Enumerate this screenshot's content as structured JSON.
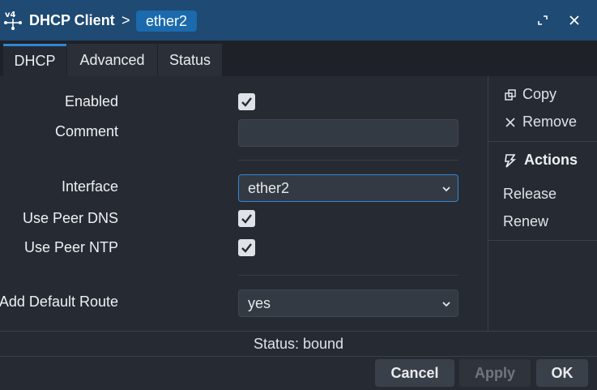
{
  "window": {
    "title": "DHCP Client",
    "separator": ">",
    "object_name": "ether2"
  },
  "tabs": [
    {
      "label": "DHCP",
      "active": true
    },
    {
      "label": "Advanced",
      "active": false
    },
    {
      "label": "Status",
      "active": false
    }
  ],
  "form": {
    "enabled_label": "Enabled",
    "enabled_checked": true,
    "comment_label": "Comment",
    "comment_value": "",
    "interface_label": "Interface",
    "interface_value": "ether2",
    "use_peer_dns_label": "Use Peer DNS",
    "use_peer_dns_checked": true,
    "use_peer_ntp_label": "Use Peer NTP",
    "use_peer_ntp_checked": true,
    "add_default_route_label": "Add Default Route",
    "add_default_route_value": "yes"
  },
  "side": {
    "copy_label": "Copy",
    "remove_label": "Remove",
    "actions_label": "Actions",
    "release_label": "Release",
    "renew_label": "Renew"
  },
  "status": {
    "text": "Status: bound"
  },
  "footer": {
    "cancel_label": "Cancel",
    "apply_label": "Apply",
    "ok_label": "OK"
  },
  "colors": {
    "titlebar": "#1f4a73",
    "chip": "#1a6aad",
    "accent": "#2f86d6",
    "background": "#262b33"
  }
}
